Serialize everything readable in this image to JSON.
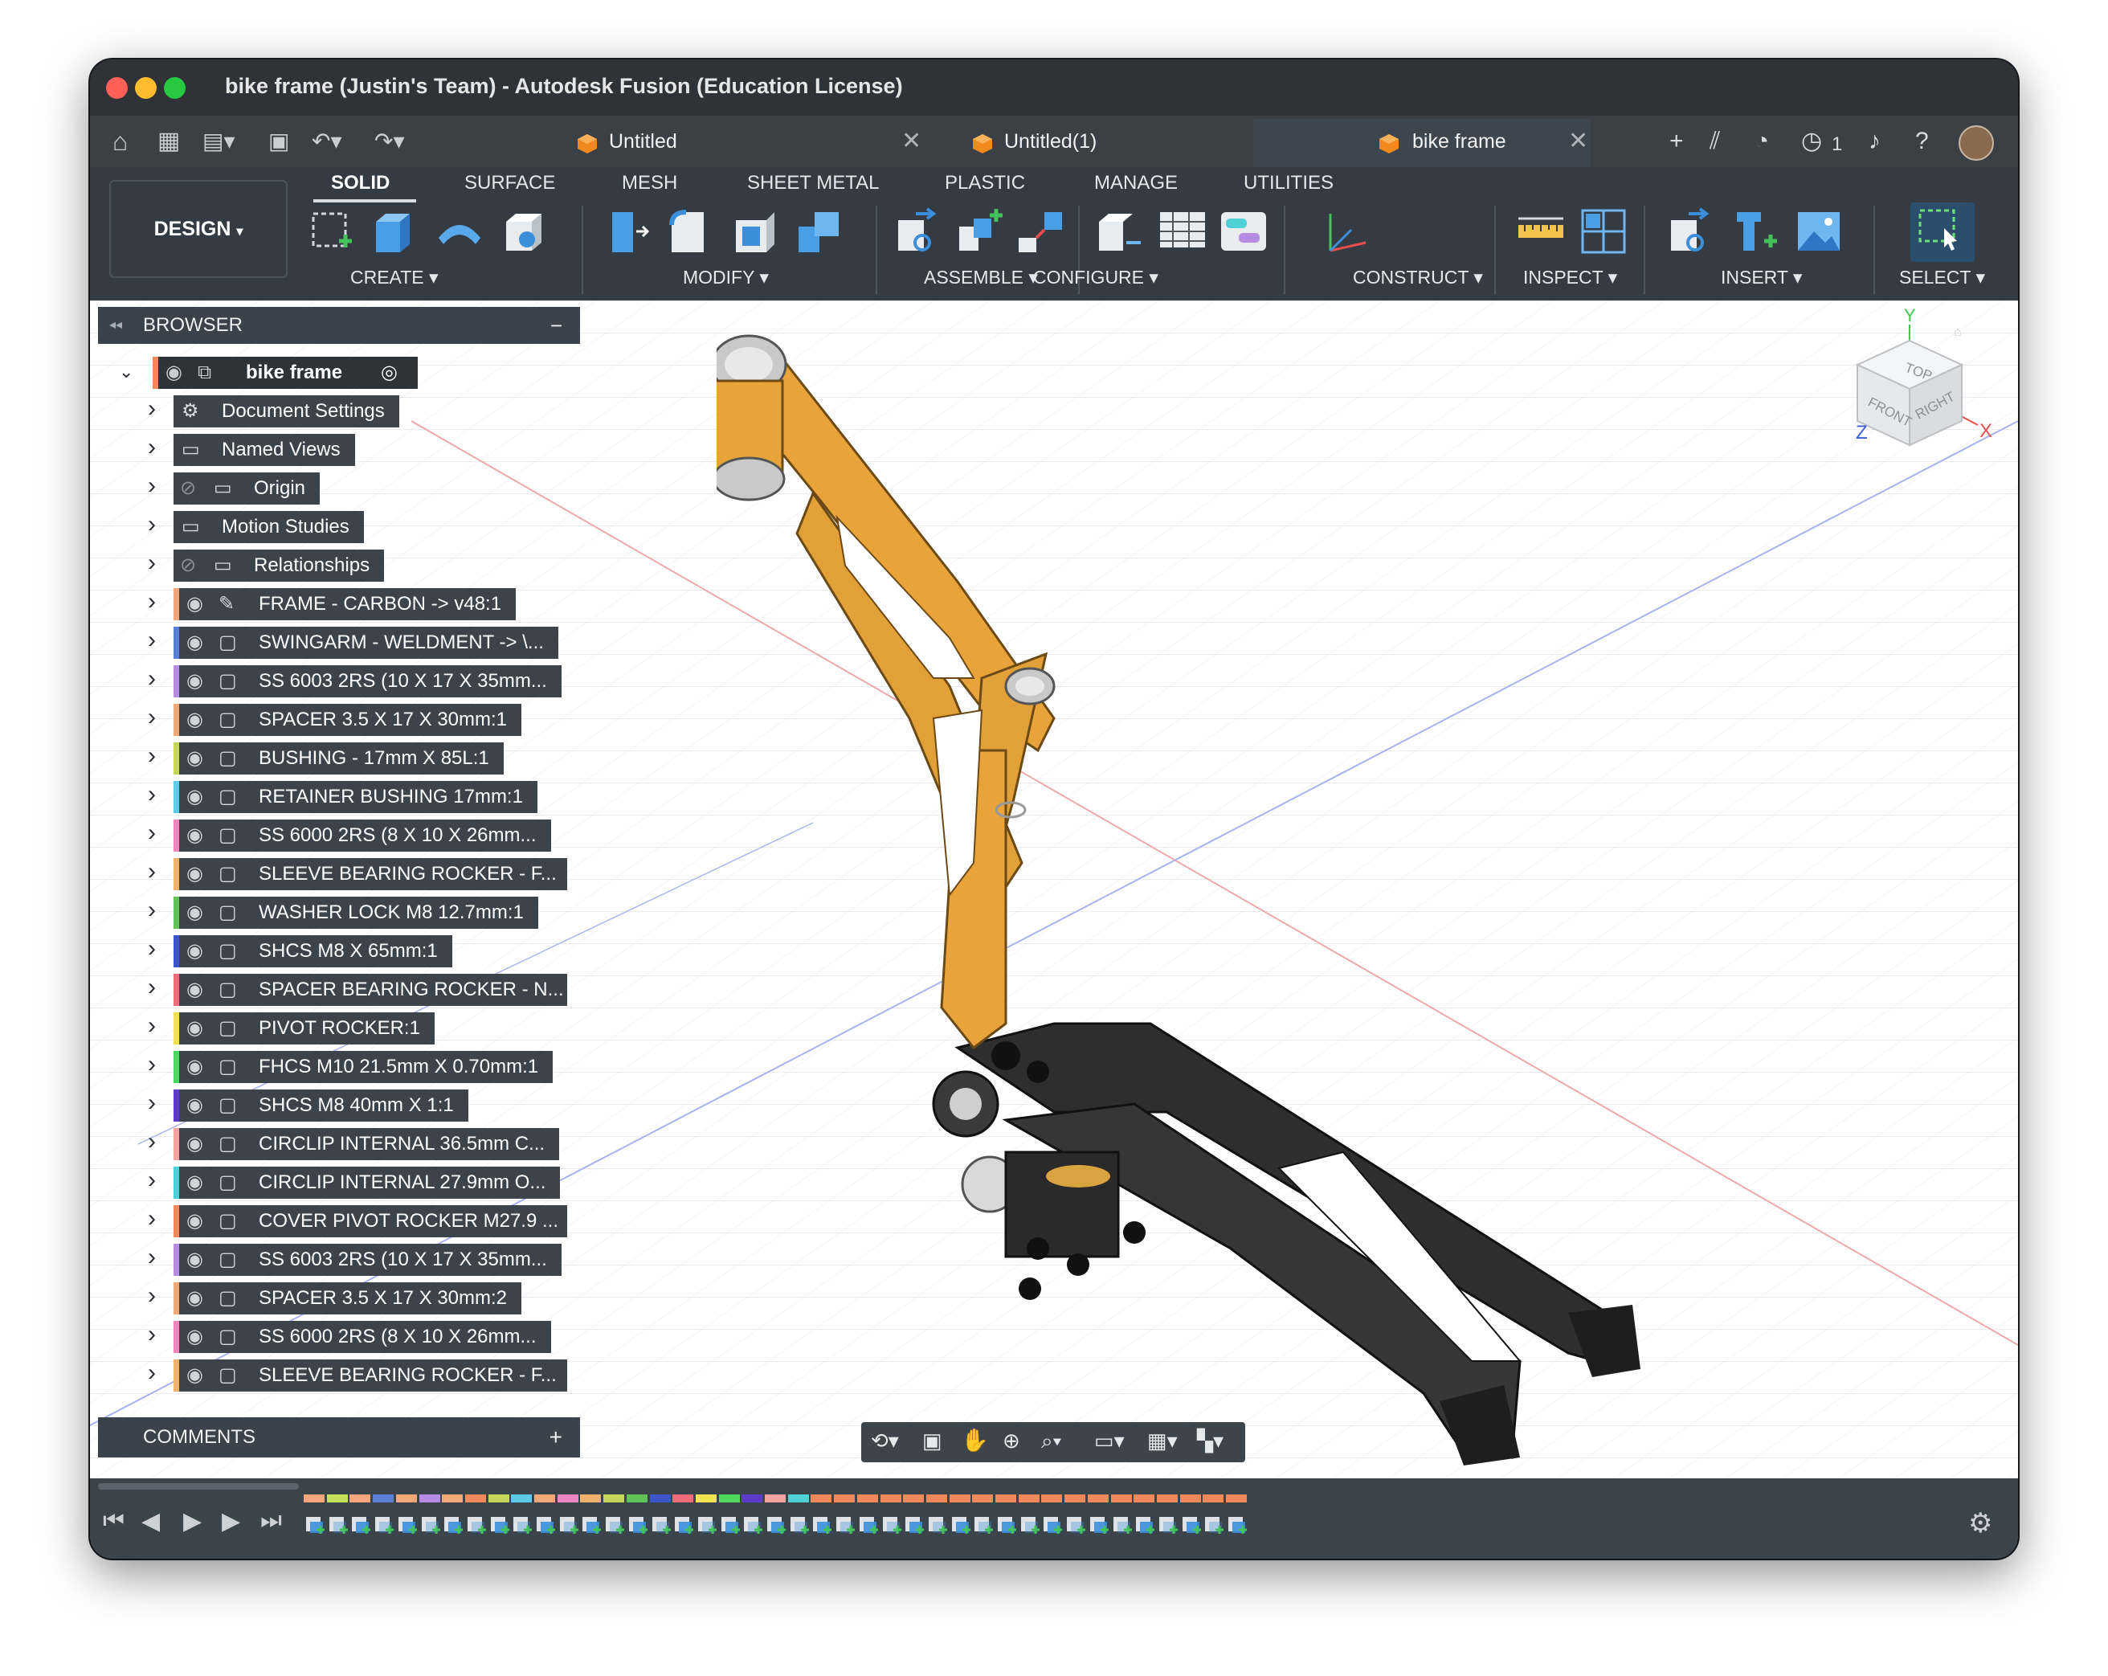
{
  "window": {
    "title": "bike frame (Justin's Team) - Autodesk Fusion (Education License)"
  },
  "tabs": [
    {
      "label": "Untitled",
      "active": false
    },
    {
      "label": "Untitled(1)",
      "active": false
    },
    {
      "label": "bike frame",
      "active": true
    }
  ],
  "topbar": {
    "job_count": "1"
  },
  "workspace": {
    "label": "DESIGN",
    "dropdown_icon": "chevron-down-icon"
  },
  "toolbar_tabs": [
    "SOLID",
    "SURFACE",
    "MESH",
    "SHEET METAL",
    "PLASTIC",
    "MANAGE",
    "UTILITIES"
  ],
  "toolbar_groups": {
    "create": "CREATE",
    "modify": "MODIFY",
    "assemble": "ASSEMBLE",
    "configure": "CONFIGURE",
    "construct": "CONSTRUCT",
    "inspect": "INSPECT",
    "insert": "INSERT",
    "select": "SELECT"
  },
  "browser": {
    "title": "BROWSER",
    "root": "bike frame",
    "items": [
      {
        "label": "Document Settings",
        "icon": "gear-icon",
        "color": ""
      },
      {
        "label": "Named Views",
        "icon": "folder-icon",
        "color": ""
      },
      {
        "label": "Origin",
        "icon": "folder-icon",
        "color": "",
        "hidden": true
      },
      {
        "label": "Motion Studies",
        "icon": "folder-icon",
        "color": ""
      },
      {
        "label": "Relationships",
        "icon": "folder-icon",
        "color": "",
        "hidden": true
      },
      {
        "label": "FRAME - CARBON -> v48:1",
        "icon": "link-component-icon",
        "color": "#f4a57a"
      },
      {
        "label": "SWINGARM - WELDMENT -> \\...",
        "icon": "component-icon",
        "color": "#5b7fd6"
      },
      {
        "label": "SS 6003 2RS (10 X 17 X 35mm...",
        "icon": "component-icon",
        "color": "#b58be3"
      },
      {
        "label": "SPACER 3.5 X 17 X 30mm:1",
        "icon": "component-icon",
        "color": "#f0a878"
      },
      {
        "label": "BUSHING - 17mm X 85L:1",
        "icon": "component-icon",
        "color": "#c6d65a"
      },
      {
        "label": "RETAINER BUSHING 17mm:1",
        "icon": "component-icon",
        "color": "#5fc9e8"
      },
      {
        "label": "SS 6000 2RS (8 X 10 X 26mm...",
        "icon": "component-icon",
        "color": "#ee86c0"
      },
      {
        "label": "SLEEVE BEARING ROCKER - F...",
        "icon": "component-icon",
        "color": "#f0b16a"
      },
      {
        "label": "WASHER LOCK M8 12.7mm:1",
        "icon": "component-icon",
        "color": "#5fc35a"
      },
      {
        "label": "SHCS M8 X 65mm:1",
        "icon": "component-icon",
        "color": "#3c56c9"
      },
      {
        "label": "SPACER BEARING ROCKER - N...",
        "icon": "component-icon",
        "color": "#ef6d7b"
      },
      {
        "label": "PIVOT ROCKER:1",
        "icon": "component-icon",
        "color": "#f2e44f"
      },
      {
        "label": "FHCS M10 21.5mm X 0.70mm:1",
        "icon": "component-icon",
        "color": "#4fd85e"
      },
      {
        "label": "SHCS M8 40mm X 1:1",
        "icon": "component-icon",
        "color": "#5a3cc9"
      },
      {
        "label": "CIRCLIP INTERNAL 36.5mm C...",
        "icon": "component-icon",
        "color": "#f5a3a0"
      },
      {
        "label": "CIRCLIP INTERNAL 27.9mm O...",
        "icon": "component-icon",
        "color": "#4fcfd6"
      },
      {
        "label": "COVER PIVOT ROCKER M27.9 ...",
        "icon": "component-icon",
        "color": "#f08a5a"
      },
      {
        "label": "SS 6003 2RS (10 X 17 X 35mm...",
        "icon": "component-icon",
        "color": "#b58be3"
      },
      {
        "label": "SPACER 3.5 X 17 X 30mm:2",
        "icon": "component-icon",
        "color": "#f0a878"
      },
      {
        "label": "SS 6000 2RS (8 X 10 X 26mm...",
        "icon": "component-icon",
        "color": "#ee86c0"
      },
      {
        "label": "SLEEVE BEARING ROCKER - F...",
        "icon": "component-icon",
        "color": "#f0b16a"
      }
    ]
  },
  "viewcube": {
    "top": "TOP",
    "front": "FRONT",
    "right": "RIGHT",
    "axis_x": "X",
    "axis_y": "Y",
    "axis_z": "Z"
  },
  "comments": {
    "title": "COMMENTS"
  },
  "colors": {
    "accent": "#0696d7",
    "frame_carbon": "#e8a43a",
    "swingarm": "#2f2f2f",
    "panel": "#3d434a"
  },
  "timeline": {
    "colors": [
      "#f4a57a",
      "#c6e05a",
      "#f4a57a",
      "#5b7fd6",
      "#f0a878",
      "#b58be3",
      "#f0a878",
      "#f08a5a",
      "#c6d65a",
      "#5fc9e8",
      "#f0a878",
      "#ee86c0",
      "#f0b16a",
      "#c6d65a",
      "#5fc35a",
      "#3c56c9",
      "#ef6d7b",
      "#f2e44f",
      "#4fd85e",
      "#5a3cc9",
      "#f5a3a0",
      "#4fcfd6",
      "#f08a5a",
      "#f08a5a",
      "#f08a5a",
      "#f08a5a",
      "#f08a5a",
      "#f08a5a",
      "#f08a5a",
      "#f08a5a",
      "#f08a5a",
      "#f08a5a",
      "#f08a5a",
      "#f08a5a",
      "#f08a5a",
      "#f08a5a",
      "#f08a5a",
      "#f08a5a",
      "#f08a5a",
      "#f08a5a",
      "#f08a5a"
    ]
  }
}
